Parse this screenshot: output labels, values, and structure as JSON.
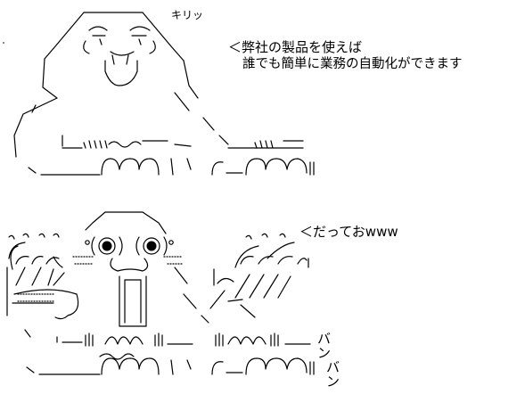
{
  "scene1": {
    "sfx": "キリッ",
    "speech_line1": "＜弊社の製品を使えば",
    "speech_line2": "誰でも簡単に業務の自動化ができます"
  },
  "scene2": {
    "speech": "＜だっておwww",
    "sfx_ban_1": "バン",
    "sfx_ban_2": "バン"
  },
  "colors": {
    "background": "#ffffff",
    "ink": "#000000"
  }
}
